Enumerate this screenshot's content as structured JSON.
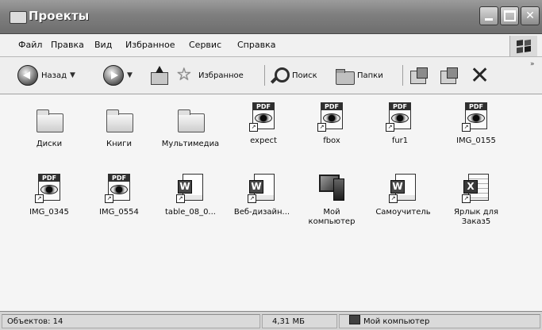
{
  "window": {
    "title": "Проекты"
  },
  "menu": [
    "Файл",
    "Правка",
    "Вид",
    "Избранное",
    "Сервис",
    "Справка"
  ],
  "toolbar": {
    "back_label": "Назад",
    "favorites_label": "Избранное",
    "search_label": "Поиск",
    "folders_label": "Папки",
    "more_label": "»"
  },
  "items": [
    {
      "label": "Диски",
      "icon": "folder-icon"
    },
    {
      "label": "Книги",
      "icon": "folder-icon"
    },
    {
      "label": "Мультимедиа",
      "icon": "folder-icon"
    },
    {
      "label": "expect",
      "icon": "pdf-shortcut-icon"
    },
    {
      "label": "fbox",
      "icon": "pdf-shortcut-icon"
    },
    {
      "label": "fur1",
      "icon": "pdf-shortcut-icon"
    },
    {
      "label": "IMG_0155",
      "icon": "pdf-shortcut-icon"
    },
    {
      "label": "IMG_0345",
      "icon": "pdf-shortcut-icon"
    },
    {
      "label": "IMG_0554",
      "icon": "pdf-shortcut-icon"
    },
    {
      "label": "table_08_0...",
      "icon": "word-shortcut-icon"
    },
    {
      "label": "Веб-дизайн...",
      "icon": "word-shortcut-icon"
    },
    {
      "label": "Мой\nкомпьютер",
      "icon": "computer-icon"
    },
    {
      "label": "Самоучитель",
      "icon": "word-shortcut-icon"
    },
    {
      "label": "Ярлык для\nЗаказ5",
      "icon": "excel-shortcut-icon"
    }
  ],
  "status": {
    "objects": "Объектов: 14",
    "size": "4,31 МБ",
    "location": "Мой компьютер"
  }
}
